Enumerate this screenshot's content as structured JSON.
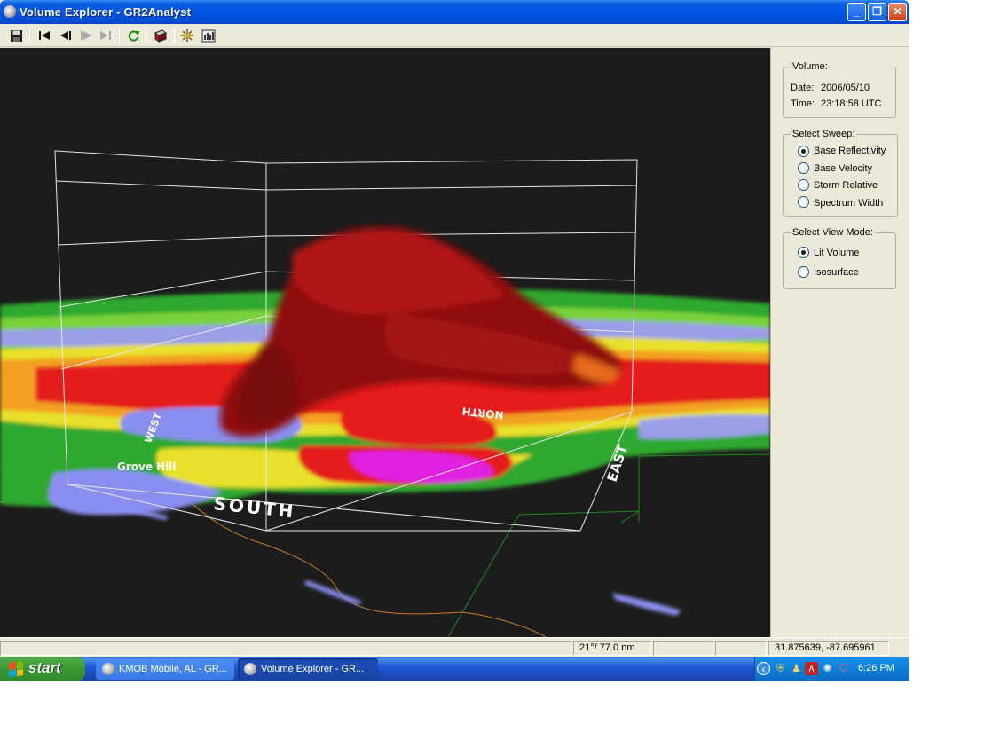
{
  "window": {
    "title": "Volume Explorer - GR2Analyst",
    "controls": {
      "minimize": "_",
      "restore": "❐",
      "close": "✕"
    }
  },
  "toolbar": {
    "items": [
      "save-icon",
      "first-frame-icon",
      "previous-frame-icon",
      "next-frame-icon",
      "last-frame-icon",
      "refresh-icon",
      "volume-cube-icon",
      "sparkle-settings-icon",
      "chart-panel-icon"
    ]
  },
  "viewport": {
    "labels": {
      "place": "Grove Hill",
      "south": "SOUTH",
      "east": "EAST",
      "west": "WEST",
      "north": "NORTH"
    }
  },
  "side_panel": {
    "volume": {
      "title": "Volume:",
      "date_label": "Date:",
      "date_value": "2006/05/10",
      "time_label": "Time:",
      "time_value": "23:18:58 UTC"
    },
    "sweep": {
      "title": "Select Sweep:",
      "options": [
        "Base Reflectivity",
        "Base Velocity",
        "Storm Relative",
        "Spectrum Width"
      ],
      "selected": "Base Reflectivity"
    },
    "view_mode": {
      "title": "Select View Mode:",
      "options": [
        "Lit Volume",
        "Isosurface"
      ],
      "selected": "Lit Volume"
    }
  },
  "status_bar": {
    "angle_range": "21°/ 77.0 nm",
    "coordinates": "31.875639, -87.695961"
  },
  "taskbar": {
    "start_label": "start",
    "tasks": [
      "KMOB Mobile, AL - GR...",
      "Volume Explorer - GR..."
    ],
    "active_task": "Volume Explorer - GR...",
    "clock": "6:26 PM",
    "tray_icons": [
      "chevron-left-icon",
      "security-shield-icon",
      "user-icon",
      "acrobat-icon",
      "network-icon",
      "antivirus-icon"
    ]
  },
  "colors": {
    "title_blue": "#0054e3",
    "taskbar_blue": "#245edb",
    "start_green": "#3c9a34",
    "viewport_bg": "#1c1c1c",
    "storm_red": "#9e0f0f"
  }
}
